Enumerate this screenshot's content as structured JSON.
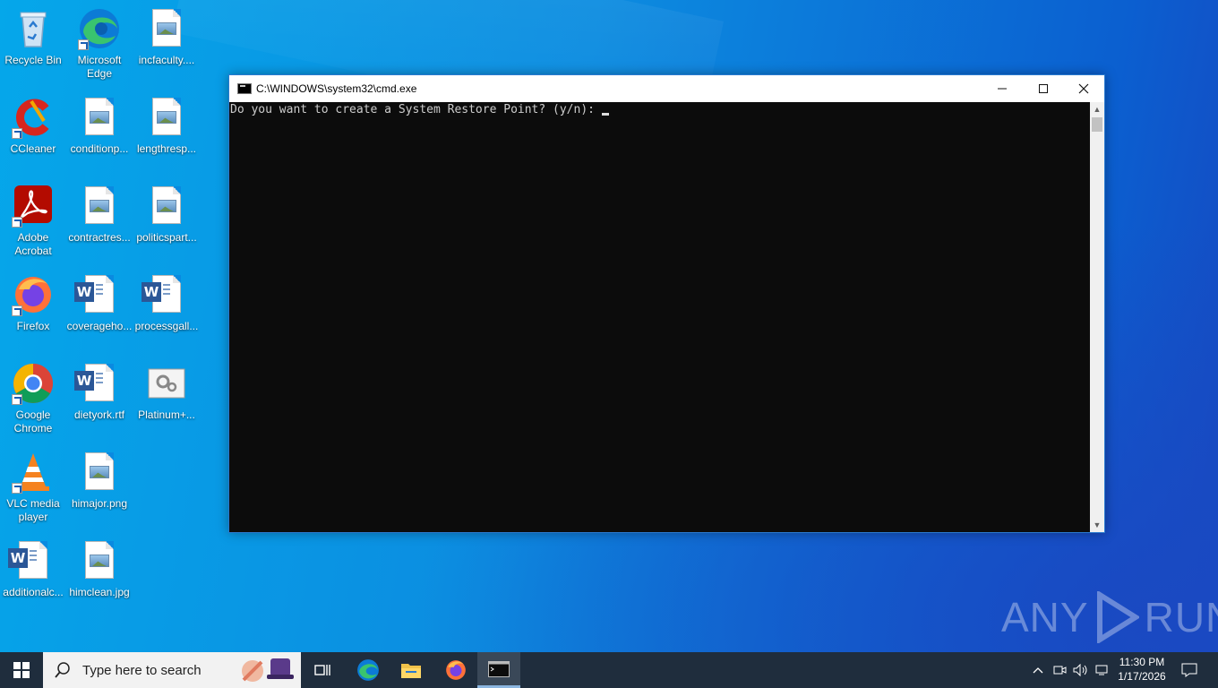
{
  "window": {
    "title": "C:\\WINDOWS\\system32\\cmd.exe",
    "console_text": "Do you want to create a System Restore Point? (y/n): "
  },
  "desktop_icons": [
    {
      "label": "Recycle Bin",
      "icon": "recycle-bin-icon"
    },
    {
      "label": "Microsoft Edge",
      "icon": "edge-icon"
    },
    {
      "label": "incfaculty....",
      "icon": "image-file-icon"
    },
    {
      "label": "CCleaner",
      "icon": "ccleaner-icon"
    },
    {
      "label": "conditionp...",
      "icon": "image-file-icon"
    },
    {
      "label": "lengthresp...",
      "icon": "image-file-icon"
    },
    {
      "label": "Adobe Acrobat",
      "icon": "acrobat-icon"
    },
    {
      "label": "contractres...",
      "icon": "image-file-icon"
    },
    {
      "label": "politicspart...",
      "icon": "image-file-icon"
    },
    {
      "label": "Firefox",
      "icon": "firefox-icon"
    },
    {
      "label": "coverageho...",
      "icon": "word-file-icon"
    },
    {
      "label": "processgall...",
      "icon": "word-file-icon"
    },
    {
      "label": "Google Chrome",
      "icon": "chrome-icon"
    },
    {
      "label": "dietyork.rtf",
      "icon": "word-file-icon"
    },
    {
      "label": "Platinum+...",
      "icon": "settings-file-icon"
    },
    {
      "label": "VLC media player",
      "icon": "vlc-icon"
    },
    {
      "label": "himajor.png",
      "icon": "image-file-icon"
    },
    {
      "label": "additionalc...",
      "icon": "word-file-icon"
    },
    {
      "label": "himclean.jpg",
      "icon": "image-file-icon"
    }
  ],
  "taskbar": {
    "search_placeholder": "Type here to search",
    "time": "11:30 PM",
    "date": "1/17/2026",
    "apps": [
      "task-view",
      "edge",
      "file-explorer",
      "firefox",
      "cmd"
    ]
  },
  "watermark": {
    "left": "ANY",
    "right": "RUN"
  },
  "colors": {
    "console_bg": "#0c0c0c",
    "taskbar": "#1f2d3d",
    "desktop": "#0a78d7"
  }
}
